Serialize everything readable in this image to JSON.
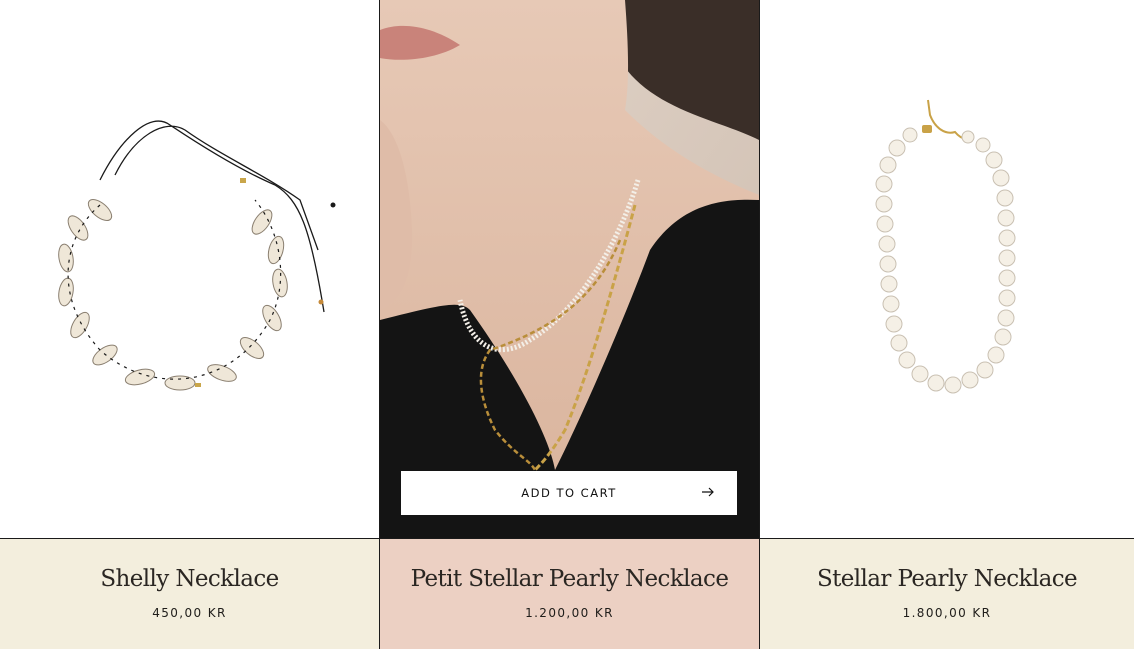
{
  "products": [
    {
      "name": "Shelly Necklace",
      "price": "450,00 KR",
      "info_bg": "#f3eedd"
    },
    {
      "name": "Petit Stellar Pearly Necklace",
      "price": "1.200,00 KR",
      "info_bg": "#ecd0c3"
    },
    {
      "name": "Stellar Pearly Necklace",
      "price": "1.800,00 KR",
      "info_bg": "#f3eedd"
    }
  ],
  "cart": {
    "label": "ADD TO CART",
    "icon": "arrow-right-icon"
  },
  "colors": {
    "border": "#1a1a1a",
    "text": "#2a2622"
  }
}
